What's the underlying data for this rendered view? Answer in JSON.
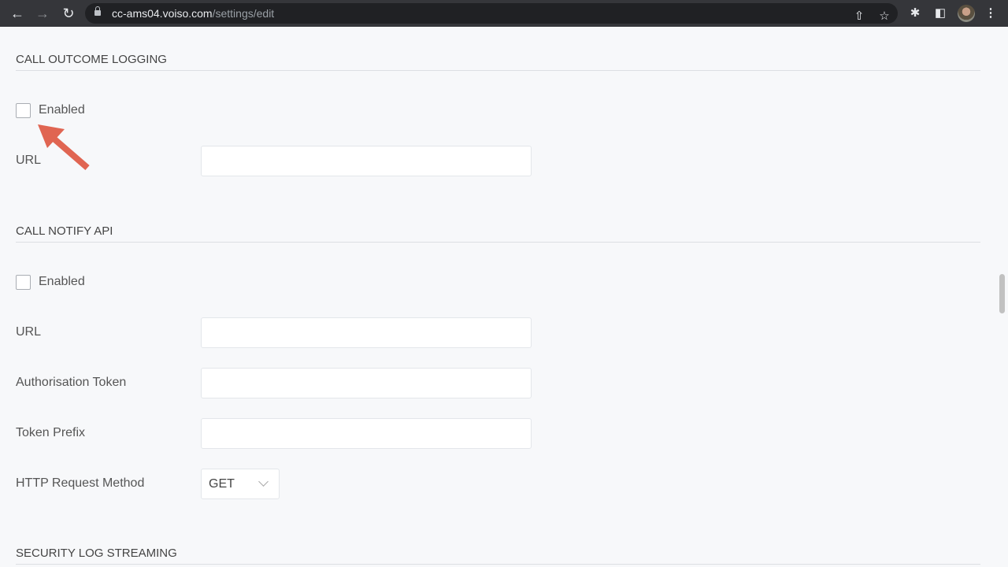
{
  "browser": {
    "url_host": "cc-ams04.voiso.com",
    "url_path": "/settings/edit",
    "icons": [
      "back-icon",
      "forward-icon",
      "reload-icon",
      "lock-icon",
      "share-icon",
      "star-icon",
      "extensions-icon",
      "side-panel-icon",
      "profile-avatar",
      "menu-icon"
    ]
  },
  "call_outcome_logging": {
    "title": "CALL OUTCOME LOGGING",
    "enabled_label": "Enabled",
    "enabled": false,
    "url_label": "URL",
    "url_value": ""
  },
  "call_notify_api": {
    "title": "CALL NOTIFY API",
    "enabled_label": "Enabled",
    "enabled": false,
    "url_label": "URL",
    "url_value": "",
    "token_label": "Authorisation Token",
    "token_value": "",
    "prefix_label": "Token Prefix",
    "prefix_value": "",
    "method_label": "HTTP Request Method",
    "method_value": "GET"
  },
  "security_log_streaming": {
    "title": "SECURITY LOG STREAMING"
  },
  "annotation": {
    "color": "#e06552",
    "icon": "arrow-pointer"
  }
}
